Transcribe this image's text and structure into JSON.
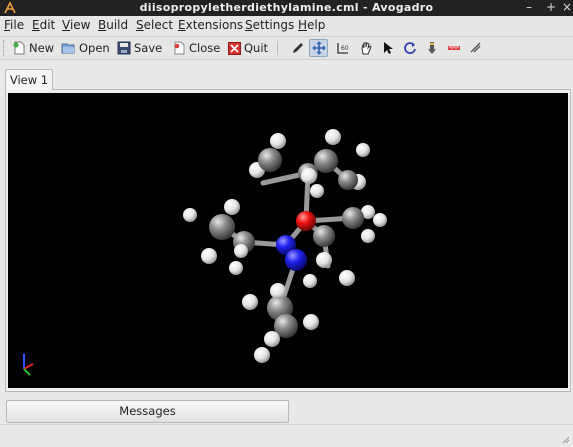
{
  "window": {
    "title": "diisopropyletherdiethylamine.cml - Avogadro",
    "controls": [
      "–",
      "+",
      "×"
    ]
  },
  "menubar": {
    "items": [
      {
        "pre": "",
        "u": "F",
        "post": "ile"
      },
      {
        "pre": "",
        "u": "E",
        "post": "dit"
      },
      {
        "pre": "",
        "u": "V",
        "post": "iew"
      },
      {
        "pre": "",
        "u": "B",
        "post": "uild"
      },
      {
        "pre": "",
        "u": "S",
        "post": "elect"
      },
      {
        "pre": "",
        "u": "E",
        "post": "xtensions"
      },
      {
        "pre": "",
        "u": "S",
        "post": "ettings"
      },
      {
        "pre": "",
        "u": "H",
        "post": "elp"
      }
    ]
  },
  "toolbar": {
    "new_label": "New",
    "open_label": "Open",
    "save_label": "Save",
    "close_label": "Close",
    "quit_label": "Quit",
    "tools": [
      "draw-tool-icon",
      "navigate-tool-icon",
      "bond-centric-manipulate-icon",
      "manipulate-tool-icon",
      "select-tool-icon",
      "auto-rotate-icon",
      "auto-optimize-icon",
      "measure-tool-icon",
      "align-tool-icon"
    ],
    "active_tool": "navigate-tool-icon"
  },
  "tabs": [
    {
      "label": "View 1",
      "selected": true
    }
  ],
  "viewport": {
    "background": "#000000",
    "atom_colors": {
      "carbon": "#8a8a8a",
      "hydrogen": "#f2f2f2",
      "nitrogen": "#2222ee",
      "oxygen": "#ee1111"
    },
    "axis_colors": {
      "x": "#e02020",
      "y": "#20c020",
      "z": "#3050ff"
    }
  },
  "messages_label": "Messages"
}
